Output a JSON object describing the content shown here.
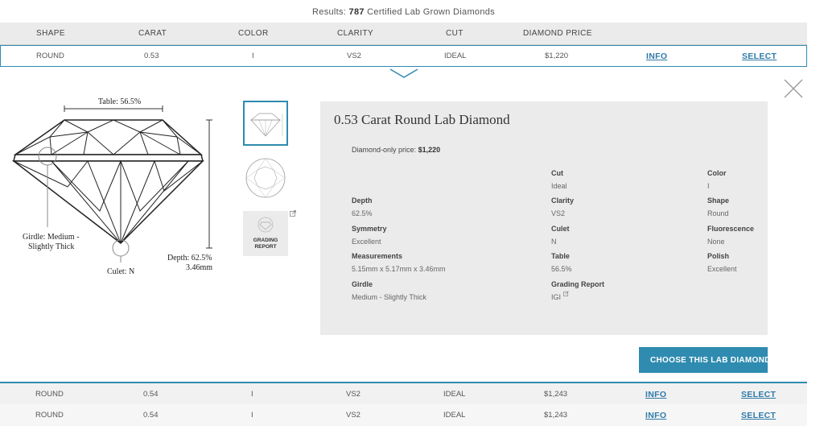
{
  "results": {
    "prefix": "Results:",
    "count": "787",
    "suffix": "Certified Lab Grown Diamonds"
  },
  "columns": [
    "SHAPE",
    "CARAT",
    "COLOR",
    "CLARITY",
    "CUT",
    "DIAMOND PRICE"
  ],
  "rows": [
    {
      "shape": "ROUND",
      "carat": "0.53",
      "color": "I",
      "clarity": "VS2",
      "cut": "IDEAL",
      "price": "$1,220",
      "info": "INFO",
      "select": "SELECT"
    },
    {
      "shape": "ROUND",
      "carat": "0.54",
      "color": "I",
      "clarity": "VS2",
      "cut": "IDEAL",
      "price": "$1,243",
      "info": "INFO",
      "select": "SELECT"
    },
    {
      "shape": "ROUND",
      "carat": "0.54",
      "color": "I",
      "clarity": "VS2",
      "cut": "IDEAL",
      "price": "$1,243",
      "info": "INFO",
      "select": "SELECT"
    }
  ],
  "diagram": {
    "table": "Table: 56.5%",
    "girdle_line1": "Girdle: Medium -",
    "girdle_line2": "Slightly Thick",
    "culet": "Culet: N",
    "depth_line1": "Depth: 62.5%",
    "depth_line2": "3.46mm"
  },
  "thumbs": {
    "grading_line1": "GRADING",
    "grading_line2": "REPORT"
  },
  "details": {
    "title": "0.53 Carat Round Lab Diamond",
    "price_label": "Diamond-only price:",
    "price_value": "$1,220",
    "specs": {
      "cut": {
        "label": "Cut",
        "value": "Ideal"
      },
      "color": {
        "label": "Color",
        "value": "I"
      },
      "depth": {
        "label": "Depth",
        "value": "62.5%"
      },
      "clarity": {
        "label": "Clarity",
        "value": "VS2"
      },
      "shape": {
        "label": "Shape",
        "value": "Round"
      },
      "symmetry": {
        "label": "Symmetry",
        "value": "Excellent"
      },
      "culet": {
        "label": "Culet",
        "value": "N"
      },
      "fluorescence": {
        "label": "Fluorescence",
        "value": "None"
      },
      "measurements": {
        "label": "Measurements",
        "value": "5.15mm x 5.17mm x 3.46mm"
      },
      "table": {
        "label": "Table",
        "value": "56.5%"
      },
      "polish": {
        "label": "Polish",
        "value": "Excellent"
      },
      "girdle": {
        "label": "Girdle",
        "value": "Medium - Slightly Thick"
      },
      "grading_report": {
        "label": "Grading Report",
        "value": "IGI"
      }
    }
  },
  "choose_button": "CHOOSE THIS LAB DIAMOND",
  "colors": {
    "accent": "#2f8bb0",
    "panel": "#ebebeb"
  }
}
